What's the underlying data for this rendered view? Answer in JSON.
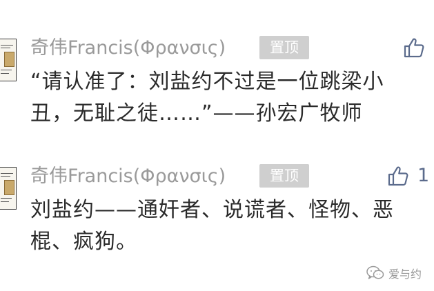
{
  "comments": [
    {
      "author": "奇伟Francis(Φρανσις)",
      "badge": "置顶",
      "like_count": "",
      "text": "“请认准了：刘盐约不过是一位跳梁小\n丑，无耻之徒……”——孙宏广牧师"
    },
    {
      "author": "奇伟Francis(Φρανσις)",
      "badge": "置顶",
      "like_count": "1",
      "text": "刘盐约——通奸者、说谎者、怪物、恶\n棍、疯狗。"
    }
  ],
  "watermark": {
    "text": "爱与约",
    "icon": "wechat-icon"
  },
  "colors": {
    "author": "#9a9a9a",
    "badge_bg": "#cfcfcf",
    "like_icon": "#5b6b8c",
    "body_text": "#2a2a2a"
  },
  "icons": {
    "like": "thumbs-up-icon",
    "avatar": "avatar-image"
  }
}
